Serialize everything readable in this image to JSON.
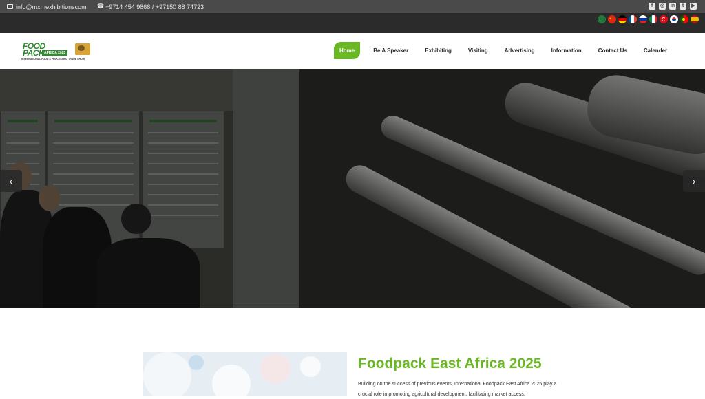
{
  "topbar": {
    "email": "info@mxmexhibitionscom",
    "phone": "+9714 454 9868 / +97150 88 74723",
    "socials": [
      {
        "icon": "facebook-icon",
        "glyph": "f"
      },
      {
        "icon": "instagram-icon",
        "glyph": "◎"
      },
      {
        "icon": "linkedin-icon",
        "glyph": "in"
      },
      {
        "icon": "twitter-icon",
        "glyph": "t"
      },
      {
        "icon": "youtube-icon",
        "glyph": "▶"
      }
    ]
  },
  "languages": [
    "arabic",
    "chinese",
    "german",
    "french",
    "russian",
    "italian",
    "turkish",
    "korean",
    "portuguese",
    "spanish"
  ],
  "logo": {
    "line1": "FOOD",
    "line2": "PACK",
    "badge": "AFRICA 2025",
    "tagline": "INTERNATIONAL FOOD & PROCESSING TRADE SHOW"
  },
  "nav": {
    "items": [
      "Home",
      "Be A Speaker",
      "Exhibiting",
      "Visiting",
      "Advertising",
      "Information",
      "Contact Us",
      "Calender"
    ],
    "active": "Home"
  },
  "hero": {
    "prev_glyph": "‹",
    "next_glyph": "›"
  },
  "about": {
    "title": "Foodpack East Africa 2025",
    "text": "Building on the success of previous events, International Foodpack East Africa 2025 play a crucial role in promoting agricultural development, facilitating market access."
  },
  "colors": {
    "accent": "#6ab924",
    "topbar": "#4a4a4a",
    "flagbar": "#2b2b2b"
  }
}
